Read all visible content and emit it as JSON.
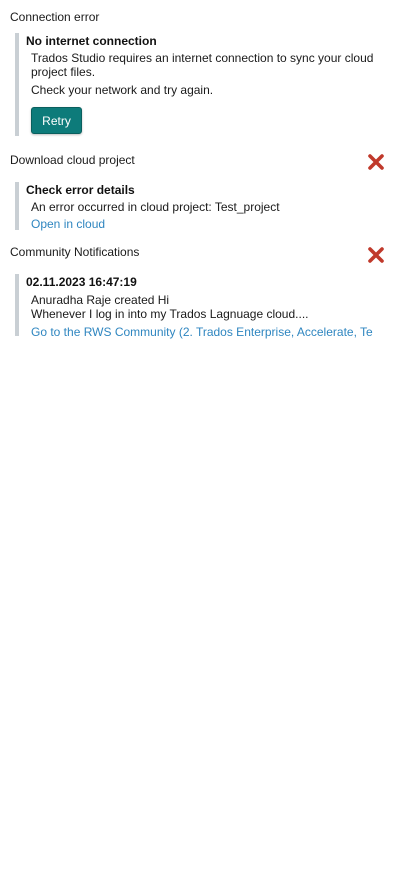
{
  "connection_error": {
    "section_title": "Connection error",
    "title": "No internet connection",
    "message_line1": "Trados Studio requires an internet connection to sync your cloud",
    "message_line2": "project files.",
    "hint": "Check your network and try again.",
    "retry_label": "Retry"
  },
  "download_cloud_project": {
    "section_title": "Download cloud project",
    "title": "Check error details",
    "message": "An error occurred in cloud project: Test_project",
    "link": "Open in cloud"
  },
  "community_notifications": {
    "section_title": "Community Notifications",
    "timestamp": "02.11.2023 16:47:19",
    "line1": "Anuradha Raje created Hi",
    "line2": "Whenever I log in into my Trados Lagnuage cloud....",
    "link": "Go to the RWS Community (2. Trados Enterprise, Accelerate, Te"
  },
  "colors": {
    "accent": "#0d7b7a",
    "link": "#2f86c0",
    "close_icon": "#c0392b",
    "card_border": "#c9cfd4"
  },
  "icons": {
    "close": "close-x-icon"
  }
}
